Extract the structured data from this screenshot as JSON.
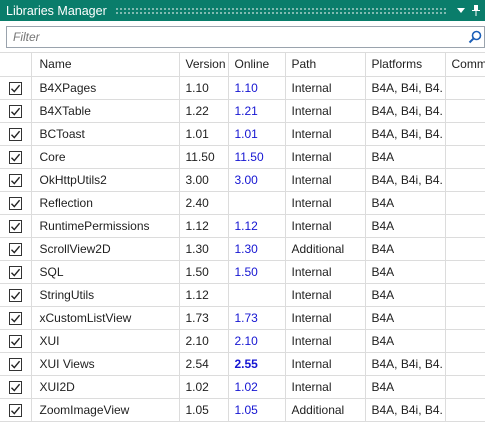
{
  "window": {
    "title": "Libraries Manager"
  },
  "filter": {
    "placeholder": "Filter",
    "value": ""
  },
  "icons": {
    "search": "search-icon",
    "dropdown": "dropdown-arrow-icon",
    "pin": "pin-icon",
    "checkbox": "checkmark-icon"
  },
  "colors": {
    "titlebar": "#0a7d6b",
    "online_link": "#1515d2",
    "grid_line": "#dcdcdc"
  },
  "table": {
    "headers": {
      "name": "Name",
      "version": "Version",
      "online": "Online",
      "path": "Path",
      "platforms": "Platforms",
      "comments": "Comm"
    },
    "rows": [
      {
        "checked": true,
        "name": "B4XPages",
        "version": "1.10",
        "online": "1.10",
        "online_newer": false,
        "path": "Internal",
        "platforms": "B4A, B4i, B4."
      },
      {
        "checked": true,
        "name": "B4XTable",
        "version": "1.22",
        "online": "1.21",
        "online_newer": false,
        "path": "Internal",
        "platforms": "B4A, B4i, B4."
      },
      {
        "checked": true,
        "name": "BCToast",
        "version": "1.01",
        "online": "1.01",
        "online_newer": false,
        "path": "Internal",
        "platforms": "B4A, B4i, B4."
      },
      {
        "checked": true,
        "name": "Core",
        "version": "11.50",
        "online": "11.50",
        "online_newer": false,
        "path": "Internal",
        "platforms": "B4A"
      },
      {
        "checked": true,
        "name": "OkHttpUtils2",
        "version": "3.00",
        "online": "3.00",
        "online_newer": false,
        "path": "Internal",
        "platforms": "B4A, B4i, B4."
      },
      {
        "checked": true,
        "name": "Reflection",
        "version": "2.40",
        "online": "",
        "online_newer": false,
        "path": "Internal",
        "platforms": "B4A"
      },
      {
        "checked": true,
        "name": "RuntimePermissions",
        "version": "1.12",
        "online": "1.12",
        "online_newer": false,
        "path": "Internal",
        "platforms": "B4A"
      },
      {
        "checked": true,
        "name": "ScrollView2D",
        "version": "1.30",
        "online": "1.30",
        "online_newer": false,
        "path": "Additional",
        "platforms": "B4A"
      },
      {
        "checked": true,
        "name": "SQL",
        "version": "1.50",
        "online": "1.50",
        "online_newer": false,
        "path": "Internal",
        "platforms": "B4A"
      },
      {
        "checked": true,
        "name": "StringUtils",
        "version": "1.12",
        "online": "",
        "online_newer": false,
        "path": "Internal",
        "platforms": "B4A"
      },
      {
        "checked": true,
        "name": "xCustomListView",
        "version": "1.73",
        "online": "1.73",
        "online_newer": false,
        "path": "Internal",
        "platforms": "B4A"
      },
      {
        "checked": true,
        "name": "XUI",
        "version": "2.10",
        "online": "2.10",
        "online_newer": false,
        "path": "Internal",
        "platforms": "B4A"
      },
      {
        "checked": true,
        "name": "XUI Views",
        "version": "2.54",
        "online": "2.55",
        "online_newer": true,
        "path": "Internal",
        "platforms": "B4A, B4i, B4."
      },
      {
        "checked": true,
        "name": "XUI2D",
        "version": "1.02",
        "online": "1.02",
        "online_newer": false,
        "path": "Internal",
        "platforms": "B4A"
      },
      {
        "checked": true,
        "name": "ZoomImageView",
        "version": "1.05",
        "online": "1.05",
        "online_newer": false,
        "path": "Additional",
        "platforms": "B4A, B4i, B4."
      }
    ]
  }
}
